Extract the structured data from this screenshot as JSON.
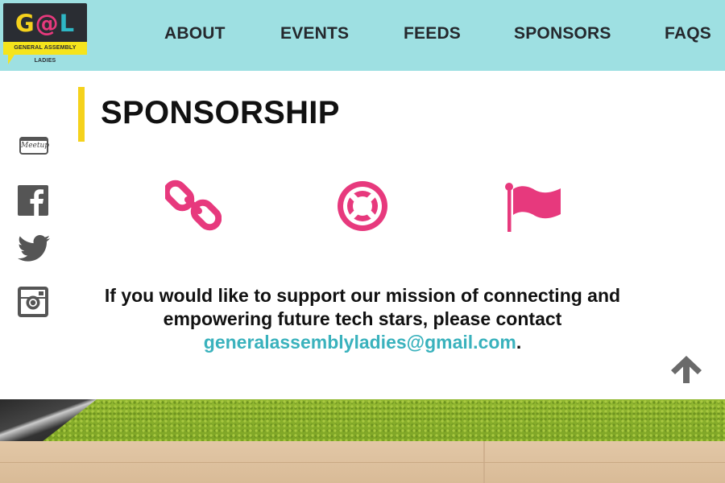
{
  "logo": {
    "letters": [
      "G",
      "@",
      "L"
    ],
    "tagline": "GENERAL ASSEMBLY LADIES"
  },
  "nav": {
    "items": [
      {
        "label": "ABOUT"
      },
      {
        "label": "EVENTS"
      },
      {
        "label": "FEEDS"
      },
      {
        "label": "SPONSORS"
      },
      {
        "label": "FAQS"
      }
    ]
  },
  "social": {
    "items": [
      {
        "icon": "meetup-icon",
        "label": "Meetup"
      },
      {
        "icon": "facebook-icon"
      },
      {
        "icon": "twitter-icon"
      },
      {
        "icon": "instagram-icon"
      }
    ]
  },
  "main": {
    "title": "SPONSORSHIP",
    "icons": [
      "chain-link-icon",
      "life-ring-icon",
      "flag-icon"
    ],
    "message_text": "If you would like to support our mission of connecting and empowering future tech stars, please contact",
    "email": "generalassemblyladies@gmail.com",
    "message_end": "."
  },
  "colors": {
    "header_bg": "#9ee0e2",
    "accent_yellow": "#f5d21c",
    "icon_pink": "#e7397d",
    "link_teal": "#3ab2bd",
    "text_dark": "#111111"
  }
}
